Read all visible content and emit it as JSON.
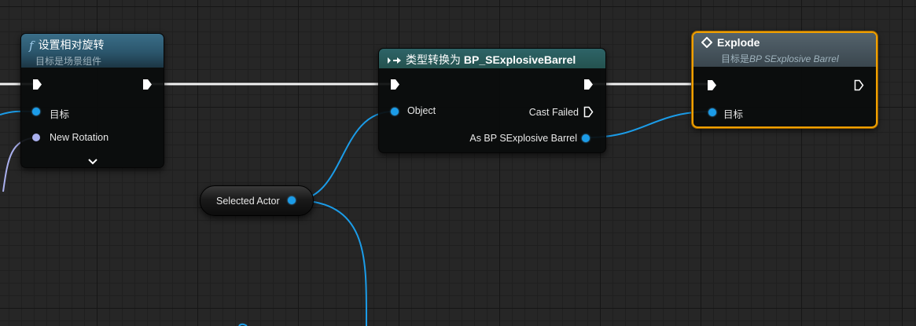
{
  "nodes": {
    "set_relative_rotation": {
      "title": "设置相对旋转",
      "subtitle": "目标是场景组件",
      "pins": {
        "target": "目标",
        "new_rotation": "New Rotation"
      }
    },
    "cast": {
      "title_prefix": "类型转换为 ",
      "title_class": "BP_SExplosiveBarrel",
      "pins": {
        "object": "Object",
        "cast_failed": "Cast Failed",
        "as_output": "As BP SExplosive Barrel"
      }
    },
    "explode": {
      "title": "Explode",
      "subtitle_prefix": "目标是",
      "subtitle_class": "BP SExplosive Barrel",
      "pins": {
        "target": "目标"
      }
    },
    "selected_actor": {
      "label": "Selected Actor"
    }
  },
  "colors": {
    "object_pin": "#1b9ce8",
    "rotator_pin": "#aab0ee",
    "exec_wire": "#ffffff",
    "selection": "#f0a000"
  },
  "icons": [
    "function-icon",
    "cast-icon",
    "event-diamond-icon",
    "expand-chevron-icon"
  ]
}
